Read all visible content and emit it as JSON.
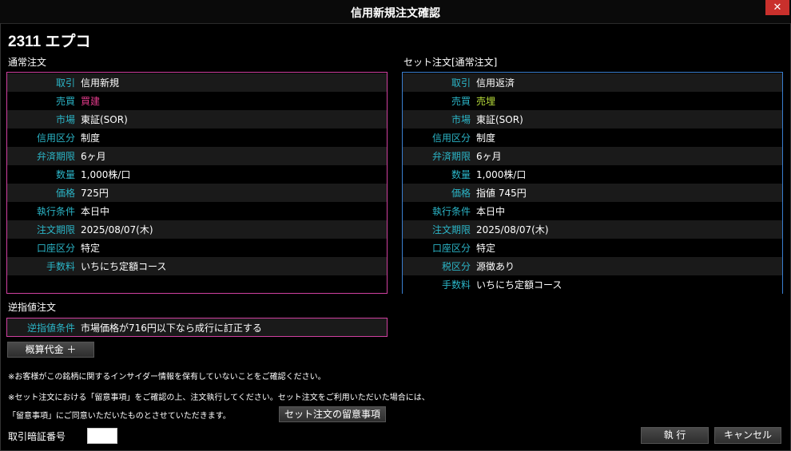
{
  "window": {
    "title": "信用新規注文確認",
    "close_glyph": "✕"
  },
  "stock": {
    "name": "2311 エプコ"
  },
  "normal_order": {
    "section_label": "通常注文",
    "rows": [
      {
        "label": "取引",
        "value": "信用新規"
      },
      {
        "label": "売買",
        "value": "買建"
      },
      {
        "label": "市場",
        "value": "東証(SOR)"
      },
      {
        "label": "信用区分",
        "value": "制度"
      },
      {
        "label": "弁済期限",
        "value": "6ヶ月"
      },
      {
        "label": "数量",
        "value": "1,000株/口"
      },
      {
        "label": "価格",
        "value": "725円"
      },
      {
        "label": "執行条件",
        "value": "本日中"
      },
      {
        "label": "注文期限",
        "value": "2025/08/07(木)"
      },
      {
        "label": "口座区分",
        "value": "特定"
      },
      {
        "label": "手数料",
        "value": "いちにち定額コース"
      }
    ]
  },
  "set_order": {
    "section_label": "セット注文[通常注文]",
    "rows": [
      {
        "label": "取引",
        "value": "信用返済"
      },
      {
        "label": "売買",
        "value": "売埋"
      },
      {
        "label": "市場",
        "value": "東証(SOR)"
      },
      {
        "label": "信用区分",
        "value": "制度"
      },
      {
        "label": "弁済期限",
        "value": "6ヶ月"
      },
      {
        "label": "数量",
        "value": "1,000株/口"
      },
      {
        "label": "価格",
        "value": "指値 745円"
      },
      {
        "label": "執行条件",
        "value": "本日中"
      },
      {
        "label": "注文期限",
        "value": "2025/08/07(木)"
      },
      {
        "label": "口座区分",
        "value": "特定"
      },
      {
        "label": "税区分",
        "value": "源徴あり"
      },
      {
        "label": "手数料",
        "value": "いちにち定額コース"
      }
    ]
  },
  "stop_order": {
    "section_label": "逆指値注文",
    "label": "逆指値条件",
    "value": "市場価格が716円以下なら成行に訂正する"
  },
  "estimate_button": "概算代金 ＋",
  "notes": {
    "insider": "※お客様がこの銘柄に関するインサイダー情報を保有していないことをご確認ください。",
    "set_line1": "※セット注文における「留意事項」をご確認の上、注文執行してください。セット注文をご利用いただいた場合には、",
    "set_line2": "「留意事項」にご同意いただいたものとさせていただきます。"
  },
  "set_notice_button": "セット注文の留意事項",
  "pin": {
    "label": "取引暗証番号",
    "value": ""
  },
  "actions": {
    "execute": "執 行",
    "cancel": "キャンセル"
  },
  "colors": {
    "buy": "#e23a8a",
    "sell": "#b7dc3a",
    "label": "#2bb5c7",
    "pink_border": "#d040a0",
    "blue_border": "#3a7fd0",
    "close": "#c9302c"
  }
}
